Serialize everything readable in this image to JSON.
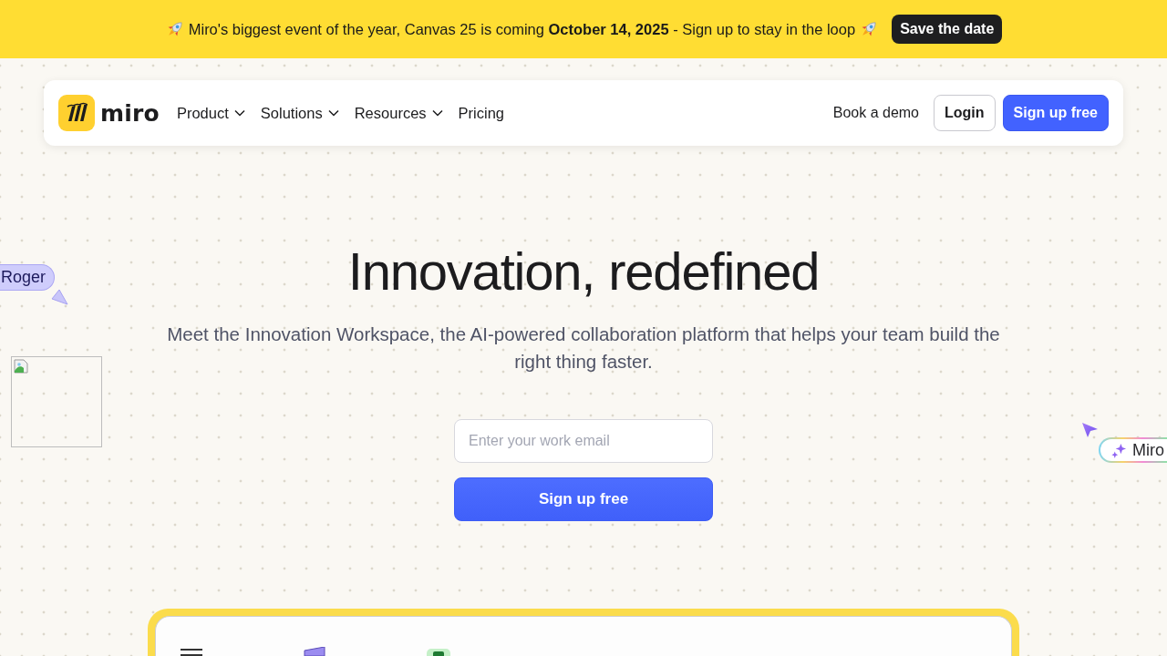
{
  "announcement": {
    "text": "Miro's biggest event of the year, Canvas 25 is coming **October 14, 2025** - Sign up to stay in the loop",
    "button": "Save the date"
  },
  "navbar": {
    "brand": "miro",
    "menu": [
      {
        "label": "Product",
        "has_dropdown": true
      },
      {
        "label": "Solutions",
        "has_dropdown": true
      },
      {
        "label": "Resources",
        "has_dropdown": true
      },
      {
        "label": "Pricing",
        "has_dropdown": false
      }
    ],
    "actions": [
      {
        "label": "Book a demo",
        "kind": "link"
      },
      {
        "label": "Login",
        "kind": "outline"
      },
      {
        "label": "Sign up free",
        "kind": "primary"
      }
    ]
  },
  "hero": {
    "title": "Innovation, redefined",
    "subtitle": "Meet the Innovation Workspace, the AI-powered collaboration platform that helps your team build the right thing faster.",
    "email_field": {
      "placeholder": "Enter your work email"
    },
    "submit": "Sign up free"
  },
  "collaborators": [
    {
      "name": "Roger",
      "kind": "person"
    },
    {
      "name": "Miro",
      "kind": "ai"
    }
  ]
}
